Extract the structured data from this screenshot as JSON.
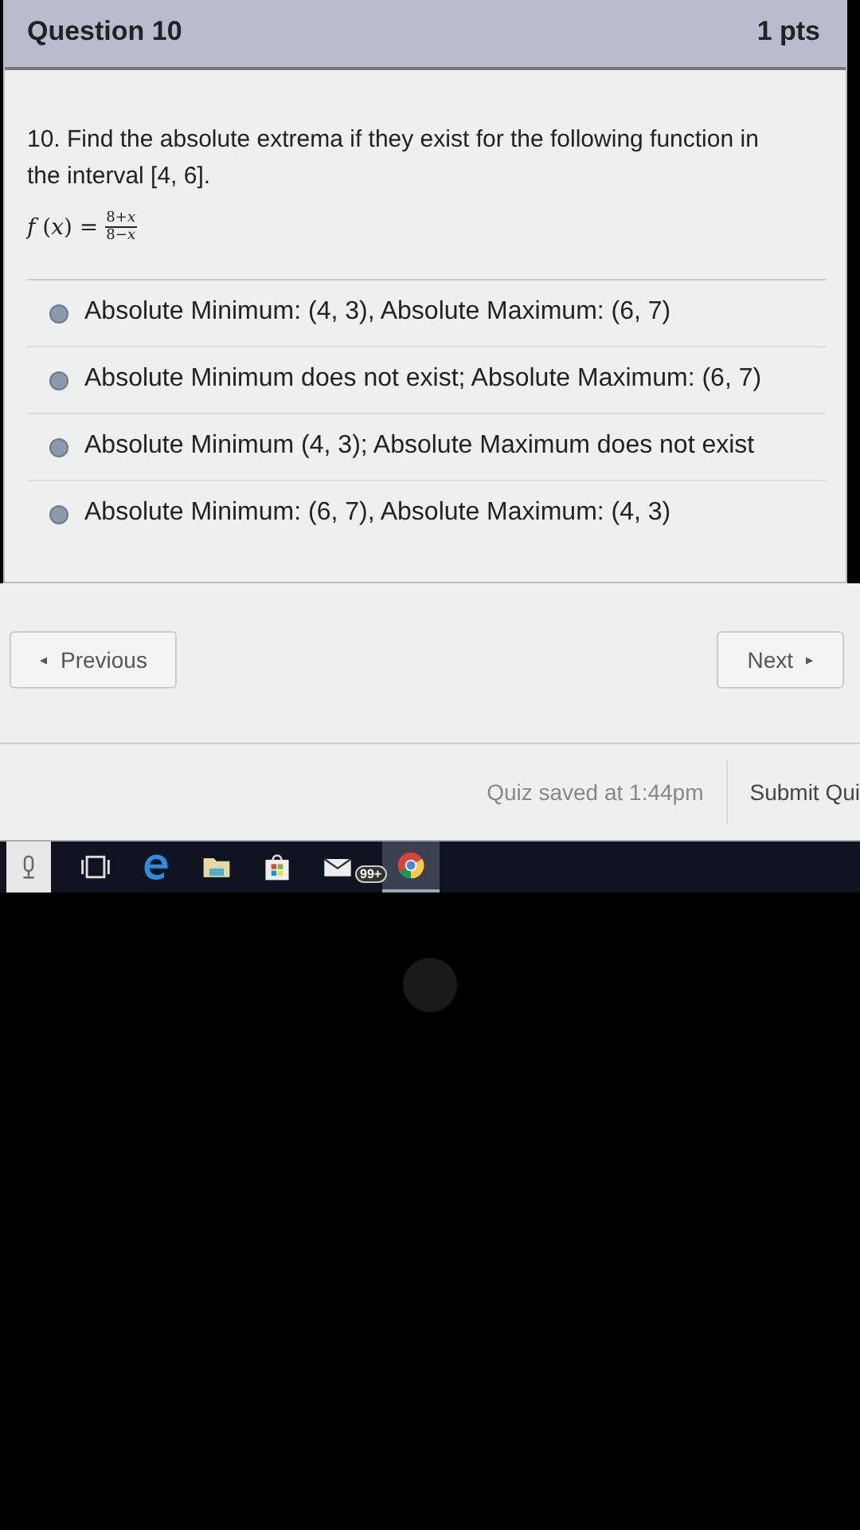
{
  "question": {
    "title": "Question 10",
    "points": "1 pts",
    "prompt": "10. Find the absolute extrema if they exist for the following function in the interval [4, 6].",
    "formula": {
      "lhs": "*f* (*x*) =",
      "numerator": "8+*x*",
      "denominator": "8−*x*"
    }
  },
  "answers": [
    {
      "text": "Absolute Minimum: (4, 3), Absolute Maximum: (6, 7)",
      "selected": false
    },
    {
      "text": "Absolute Minimum does not exist; Absolute Maximum: (6, 7)",
      "selected": false
    },
    {
      "text": "Absolute Minimum (4, 3); Absolute Maximum does not exist",
      "selected": false
    },
    {
      "text": "Absolute Minimum: (6, 7), Absolute Maximum: (4, 3)",
      "selected": false
    }
  ],
  "nav": {
    "previous": {
      "arrow": "◂",
      "label": "Previous"
    },
    "next": {
      "label": "Next",
      "arrow": "▸"
    }
  },
  "footer": {
    "saved": "Quiz saved at 1:44pm",
    "submit": "Submit Qui"
  },
  "taskbar": {
    "mail_badge": "99+"
  }
}
